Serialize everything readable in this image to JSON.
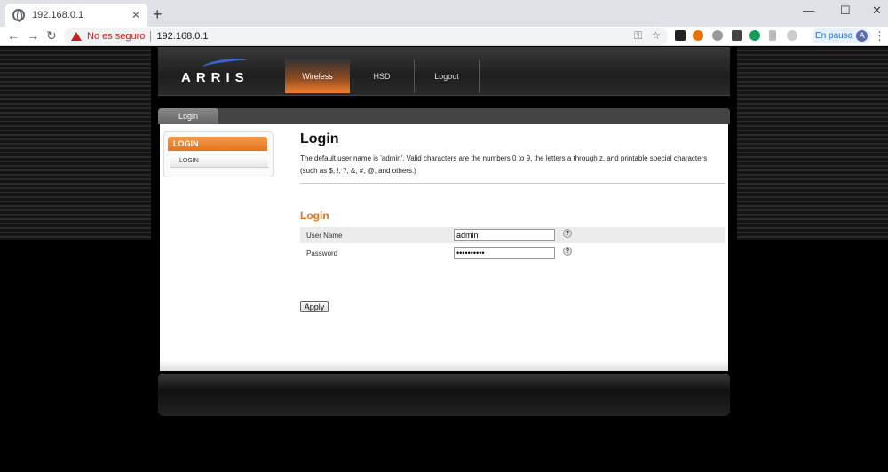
{
  "browser": {
    "tab_title": "192.168.0.1",
    "tab_close": "✕",
    "new_tab": "+",
    "win_min": "—",
    "win_max": "☐",
    "win_close": "✕",
    "back": "←",
    "forward": "→",
    "reload": "↻",
    "security_label": "No es seguro",
    "url": "192.168.0.1",
    "key_icon": "⚿",
    "star_icon": "☆",
    "profile_status": "En pausa",
    "avatar_letter": "A",
    "menu": "⋮",
    "colors": {
      "insecure": "#c5221f",
      "accent": "#1a73e8"
    }
  },
  "router": {
    "logo": "ARRIS",
    "nav": [
      {
        "label": "Wireless",
        "active": true
      },
      {
        "label": "HSD",
        "active": false
      },
      {
        "label": "Logout",
        "active": false
      }
    ],
    "panel_tab": "Login",
    "sidebar": {
      "header": "LOGIN",
      "items": [
        "LOGIN"
      ]
    },
    "page_title": "Login",
    "description": "The default user name is 'admin'. Valid characters are the numbers 0 to 9, the letters a through z, and printable special characters (such as $, !, ?, &, #, @, and others.)",
    "section_title": "Login",
    "fields": [
      {
        "label": "User Name",
        "value": "admin",
        "type": "text",
        "help": "?"
      },
      {
        "label": "Password",
        "value": "password12",
        "type": "password",
        "help": "?"
      }
    ],
    "apply_label": "Apply",
    "colors": {
      "accent_orange": "#e77418",
      "header_dark": "#1e1e1e"
    }
  }
}
